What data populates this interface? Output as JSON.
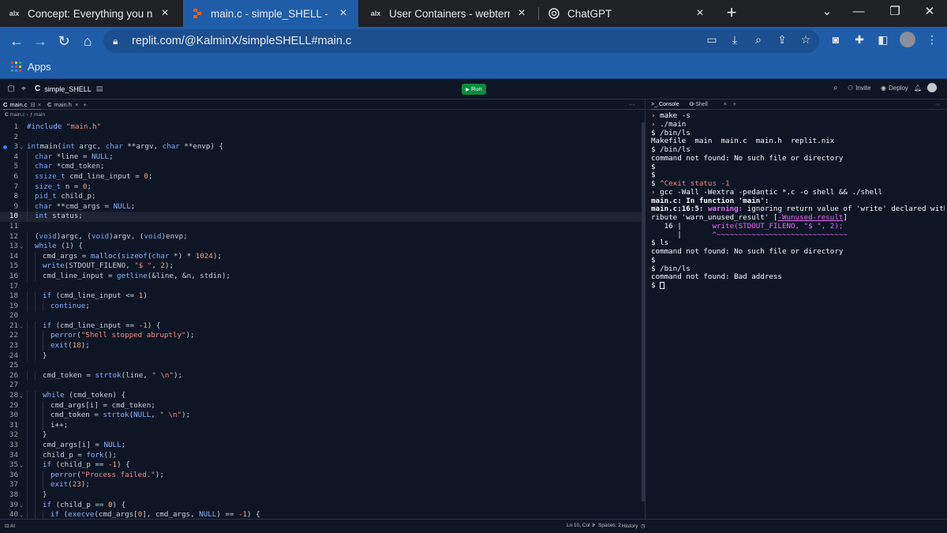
{
  "browser": {
    "tabs": [
      {
        "title": "Concept: Everything you need to",
        "favicon": "alx",
        "active": false
      },
      {
        "title": "main.c - simple_SHELL - Replit",
        "favicon": "replit",
        "active": true
      },
      {
        "title": "User Containers - webterm | Lag",
        "favicon": "alx",
        "active": false
      },
      {
        "title": "ChatGPT",
        "favicon": "chatgpt",
        "active": false
      }
    ],
    "close_glyph": "×",
    "new_tab_glyph": "+",
    "url": "replit.com/@KalminX/simpleSHELL#main.c",
    "bookmarks": {
      "apps_label": "Apps"
    }
  },
  "replit": {
    "repl_name": "simple_SHELL",
    "run_label": "Run",
    "invite_label": "Invite",
    "deploy_label": "Deploy",
    "editor_tabs": [
      {
        "label": "main.c",
        "active": true
      },
      {
        "label": "main.h",
        "active": false
      }
    ],
    "breadcrumb": {
      "file": "main.c",
      "symbol": "main"
    },
    "console_tabs": [
      {
        "label": "Console",
        "active": true
      },
      {
        "label": "Shell",
        "active": false
      }
    ],
    "status": {
      "left": "AI",
      "position": "Ln 10, Col 1",
      "spaces": "Spaces: 2",
      "history": "History"
    }
  },
  "code": {
    "current_line": 10,
    "breakpoint_line": 3,
    "lines": [
      {
        "n": 1,
        "indent": 0,
        "tokens": [
          [
            "pr",
            "#include "
          ],
          [
            "st",
            "\"main.h\""
          ]
        ]
      },
      {
        "n": 2,
        "indent": 0,
        "tokens": []
      },
      {
        "n": 3,
        "indent": 0,
        "fold": true,
        "tokens": [
          [
            "ty",
            "int"
          ],
          [
            "",
            "main("
          ],
          [
            "ty",
            "int"
          ],
          [
            "",
            " argc, "
          ],
          [
            "ty",
            "char"
          ],
          [
            "",
            " **argv, "
          ],
          [
            "ty",
            "char"
          ],
          [
            "",
            " **envp) {"
          ]
        ]
      },
      {
        "n": 4,
        "indent": 1,
        "tokens": [
          [
            "ty",
            "char"
          ],
          [
            "",
            " *line = "
          ],
          [
            "kw",
            "NULL"
          ],
          [
            "",
            ";"
          ]
        ]
      },
      {
        "n": 5,
        "indent": 1,
        "tokens": [
          [
            "ty",
            "char"
          ],
          [
            "",
            " *cmd_token;"
          ]
        ]
      },
      {
        "n": 6,
        "indent": 1,
        "tokens": [
          [
            "ty",
            "ssize_t"
          ],
          [
            "",
            " cmd_line_input = "
          ],
          [
            "nu",
            "0"
          ],
          [
            "",
            ";"
          ]
        ]
      },
      {
        "n": 7,
        "indent": 1,
        "tokens": [
          [
            "ty",
            "size_t"
          ],
          [
            "",
            " n = "
          ],
          [
            "nu",
            "0"
          ],
          [
            "",
            ";"
          ]
        ]
      },
      {
        "n": 8,
        "indent": 1,
        "tokens": [
          [
            "ty",
            "pid_t"
          ],
          [
            "",
            " child_p;"
          ]
        ]
      },
      {
        "n": 9,
        "indent": 1,
        "tokens": [
          [
            "ty",
            "char"
          ],
          [
            "",
            " **cmd_args = "
          ],
          [
            "kw",
            "NULL"
          ],
          [
            "",
            ";"
          ]
        ]
      },
      {
        "n": 10,
        "indent": 1,
        "tokens": [
          [
            "ty",
            "int"
          ],
          [
            "",
            " status;"
          ]
        ]
      },
      {
        "n": 11,
        "indent": 0,
        "tokens": []
      },
      {
        "n": 12,
        "indent": 1,
        "tokens": [
          [
            "",
            "("
          ],
          [
            "ty",
            "void"
          ],
          [
            "",
            ")argc, ("
          ],
          [
            "ty",
            "void"
          ],
          [
            "",
            ")argv, ("
          ],
          [
            "ty",
            "void"
          ],
          [
            "",
            ")envp;"
          ]
        ]
      },
      {
        "n": 13,
        "indent": 1,
        "fold": true,
        "tokens": [
          [
            "kw",
            "while"
          ],
          [
            "",
            " ("
          ],
          [
            "nu",
            "1"
          ],
          [
            "",
            ") {"
          ]
        ]
      },
      {
        "n": 14,
        "indent": 2,
        "tokens": [
          [
            "",
            "cmd_args = "
          ],
          [
            "kw",
            "malloc"
          ],
          [
            "",
            "("
          ],
          [
            "kw",
            "sizeof"
          ],
          [
            "",
            "("
          ],
          [
            "ty",
            "char"
          ],
          [
            "",
            " *) * "
          ],
          [
            "nu",
            "1024"
          ],
          [
            "",
            ");"
          ]
        ]
      },
      {
        "n": 15,
        "indent": 2,
        "tokens": [
          [
            "kw",
            "write"
          ],
          [
            "",
            "(STDOUT_FILENO, "
          ],
          [
            "st",
            "\"$ \""
          ],
          [
            "",
            ", "
          ],
          [
            "nu",
            "2"
          ],
          [
            "",
            ");"
          ]
        ]
      },
      {
        "n": 16,
        "indent": 2,
        "tokens": [
          [
            "",
            "cmd_line_input = "
          ],
          [
            "kw",
            "getline"
          ],
          [
            "",
            "(&line, &n, stdin);"
          ]
        ]
      },
      {
        "n": 17,
        "indent": 0,
        "tokens": []
      },
      {
        "n": 18,
        "indent": 2,
        "tokens": [
          [
            "kw",
            "if"
          ],
          [
            "",
            " (cmd_line_input <= "
          ],
          [
            "nu",
            "1"
          ],
          [
            "",
            ")"
          ]
        ]
      },
      {
        "n": 19,
        "indent": 3,
        "tokens": [
          [
            "kw",
            "continue"
          ],
          [
            "",
            ";"
          ]
        ]
      },
      {
        "n": 20,
        "indent": 0,
        "tokens": []
      },
      {
        "n": 21,
        "indent": 2,
        "fold": true,
        "tokens": [
          [
            "kw",
            "if"
          ],
          [
            "",
            " (cmd_line_input == "
          ],
          [
            "nu",
            "-1"
          ],
          [
            "",
            ") {"
          ]
        ]
      },
      {
        "n": 22,
        "indent": 3,
        "tokens": [
          [
            "kw",
            "perror"
          ],
          [
            "",
            "("
          ],
          [
            "st",
            "\"Shell stopped abruptly\""
          ],
          [
            "",
            ");"
          ]
        ]
      },
      {
        "n": 23,
        "indent": 3,
        "tokens": [
          [
            "kw",
            "exit"
          ],
          [
            "",
            "("
          ],
          [
            "nu",
            "18"
          ],
          [
            "",
            ");"
          ]
        ]
      },
      {
        "n": 24,
        "indent": 2,
        "tokens": [
          [
            "",
            "}"
          ]
        ]
      },
      {
        "n": 25,
        "indent": 0,
        "tokens": []
      },
      {
        "n": 26,
        "indent": 2,
        "tokens": [
          [
            "",
            "cmd_token = "
          ],
          [
            "kw",
            "strtok"
          ],
          [
            "",
            "(line, "
          ],
          [
            "st",
            "\" \\n\""
          ],
          [
            "",
            ");"
          ]
        ]
      },
      {
        "n": 27,
        "indent": 0,
        "tokens": []
      },
      {
        "n": 28,
        "indent": 2,
        "fold": true,
        "tokens": [
          [
            "kw",
            "while"
          ],
          [
            "",
            " (cmd_token) {"
          ]
        ]
      },
      {
        "n": 29,
        "indent": 3,
        "tokens": [
          [
            "",
            "cmd_args[i] = cmd_token;"
          ]
        ]
      },
      {
        "n": 30,
        "indent": 3,
        "tokens": [
          [
            "",
            "cmd_token = "
          ],
          [
            "kw",
            "strtok"
          ],
          [
            "",
            "("
          ],
          [
            "kw",
            "NULL"
          ],
          [
            "",
            ", "
          ],
          [
            "st",
            "\" \\n\""
          ],
          [
            "",
            ");"
          ]
        ]
      },
      {
        "n": 31,
        "indent": 3,
        "tokens": [
          [
            "",
            "i++;"
          ]
        ]
      },
      {
        "n": 32,
        "indent": 2,
        "tokens": [
          [
            "",
            "}"
          ]
        ]
      },
      {
        "n": 33,
        "indent": 2,
        "tokens": [
          [
            "",
            "cmd_args[i] = "
          ],
          [
            "kw",
            "NULL"
          ],
          [
            "",
            ";"
          ]
        ]
      },
      {
        "n": 34,
        "indent": 2,
        "tokens": [
          [
            "",
            "child_p = "
          ],
          [
            "kw",
            "fork"
          ],
          [
            "",
            "();"
          ]
        ]
      },
      {
        "n": 35,
        "indent": 2,
        "fold": true,
        "tokens": [
          [
            "kw",
            "if"
          ],
          [
            "",
            " (child_p == "
          ],
          [
            "nu",
            "-1"
          ],
          [
            "",
            ") {"
          ]
        ]
      },
      {
        "n": 36,
        "indent": 3,
        "tokens": [
          [
            "kw",
            "perror"
          ],
          [
            "",
            "("
          ],
          [
            "st",
            "\"Process failed.\""
          ],
          [
            "",
            ");"
          ]
        ]
      },
      {
        "n": 37,
        "indent": 3,
        "tokens": [
          [
            "kw",
            "exit"
          ],
          [
            "",
            "("
          ],
          [
            "nu",
            "23"
          ],
          [
            "",
            ");"
          ]
        ]
      },
      {
        "n": 38,
        "indent": 2,
        "tokens": [
          [
            "",
            "}"
          ]
        ]
      },
      {
        "n": 39,
        "indent": 2,
        "fold": true,
        "tokens": [
          [
            "kw",
            "if"
          ],
          [
            "",
            " (child_p == "
          ],
          [
            "nu",
            "0"
          ],
          [
            "",
            ") {"
          ]
        ]
      },
      {
        "n": 40,
        "indent": 3,
        "fold": true,
        "tokens": [
          [
            "kw",
            "if"
          ],
          [
            "",
            " ("
          ],
          [
            "kw",
            "execve"
          ],
          [
            "",
            "(cmd_args["
          ],
          [
            "nu",
            "0"
          ],
          [
            "",
            "], cmd_args, "
          ],
          [
            "kw",
            "NULL"
          ],
          [
            "",
            ") == "
          ],
          [
            "nu",
            "-1"
          ],
          [
            "",
            ") {"
          ]
        ]
      }
    ]
  },
  "console": {
    "lines": [
      {
        "kind": "cmd",
        "text": "make -s"
      },
      {
        "kind": "cmd",
        "text": "./main"
      },
      {
        "kind": "plain",
        "text": "$ /bin/ls"
      },
      {
        "kind": "plain",
        "text": "Makefile  main  main.c  main.h  replit.nix"
      },
      {
        "kind": "plain",
        "text": "$ /bin/ls"
      },
      {
        "kind": "plain",
        "text": "command not found: No such file or directory"
      },
      {
        "kind": "plain",
        "text": "$"
      },
      {
        "kind": "plain",
        "text": "$"
      },
      {
        "kind": "exit",
        "prefix": "$ ",
        "text": "^Cexit status -1"
      },
      {
        "kind": "cmd",
        "text": "gcc -Wall -Wextra -pedantic *.c -o shell && ./shell"
      },
      {
        "kind": "plain",
        "text": "main.c: In function 'main':",
        "bold": true
      },
      {
        "kind": "warn",
        "loc": "main.c:16:5:",
        "label": "warning:",
        "text": " ignoring return value of 'write' declared with att"
      },
      {
        "kind": "attr",
        "a": "ribute 'warn_unused_result' [",
        "b": "-Wunused-result",
        "c": "]"
      },
      {
        "kind": "src",
        "gutter": "   16 |",
        "text": "       write(STDOUT_FILENO, \"$ \", 2);"
      },
      {
        "kind": "tilde",
        "gutter": "      |",
        "text": "       ^~~~~~~~~~~~~~~~~~~~~~~~~~~~~~~"
      },
      {
        "kind": "plain",
        "text": "$ ls"
      },
      {
        "kind": "plain",
        "text": "command not found: No such file or directory"
      },
      {
        "kind": "plain",
        "text": "$"
      },
      {
        "kind": "plain",
        "text": "$ /bin/ls"
      },
      {
        "kind": "plain",
        "text": "command not found: Bad address"
      },
      {
        "kind": "cursor",
        "text": "$ "
      }
    ]
  }
}
